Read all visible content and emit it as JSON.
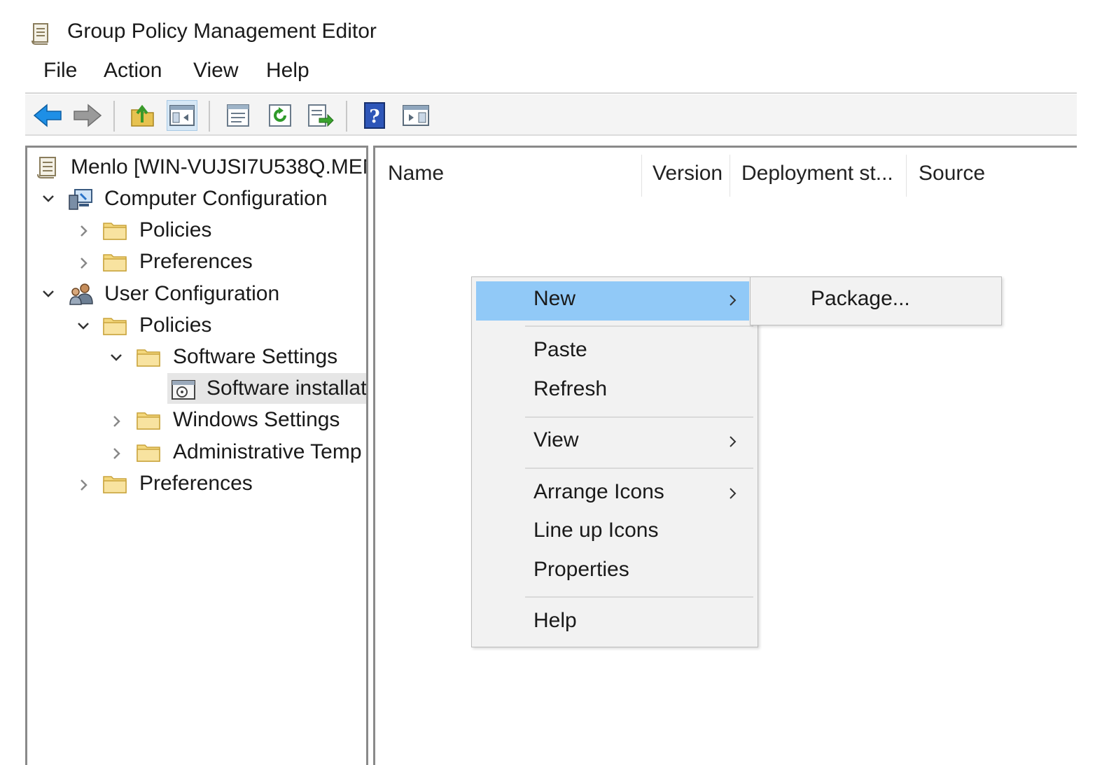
{
  "window": {
    "title": "Group Policy Management Editor"
  },
  "menubar": {
    "items": [
      "File",
      "Action",
      "View",
      "Help"
    ]
  },
  "toolbar": {
    "buttons": [
      {
        "name": "back-arrow-icon"
      },
      {
        "name": "forward-arrow-icon"
      },
      {
        "name": "up-folder-icon"
      },
      {
        "name": "show-hide-console-tree-icon"
      },
      {
        "name": "properties-icon"
      },
      {
        "name": "refresh-icon"
      },
      {
        "name": "export-list-icon"
      },
      {
        "name": "help-icon"
      },
      {
        "name": "show-hide-action-pane-icon"
      }
    ]
  },
  "tree": {
    "root": "Menlo [WIN-VUJSI7U538Q.MEN",
    "computer_configuration": "Computer Configuration",
    "cc_policies": "Policies",
    "cc_preferences": "Preferences",
    "user_configuration": "User Configuration",
    "uc_policies": "Policies",
    "software_settings": "Software Settings",
    "software_installation": "Software installat",
    "windows_settings": "Windows Settings",
    "administrative_templates": "Administrative Temp",
    "uc_preferences": "Preferences"
  },
  "list": {
    "columns": [
      "Name",
      "Version",
      "Deployment st...",
      "Source"
    ]
  },
  "context_menu": {
    "items": {
      "new": "New",
      "paste": "Paste",
      "refresh": "Refresh",
      "view": "View",
      "arrange_icons": "Arrange Icons",
      "line_up_icons": "Line up Icons",
      "properties": "Properties",
      "help": "Help"
    },
    "highlight_color": "#91c9f7",
    "submenu": {
      "package": "Package..."
    }
  }
}
